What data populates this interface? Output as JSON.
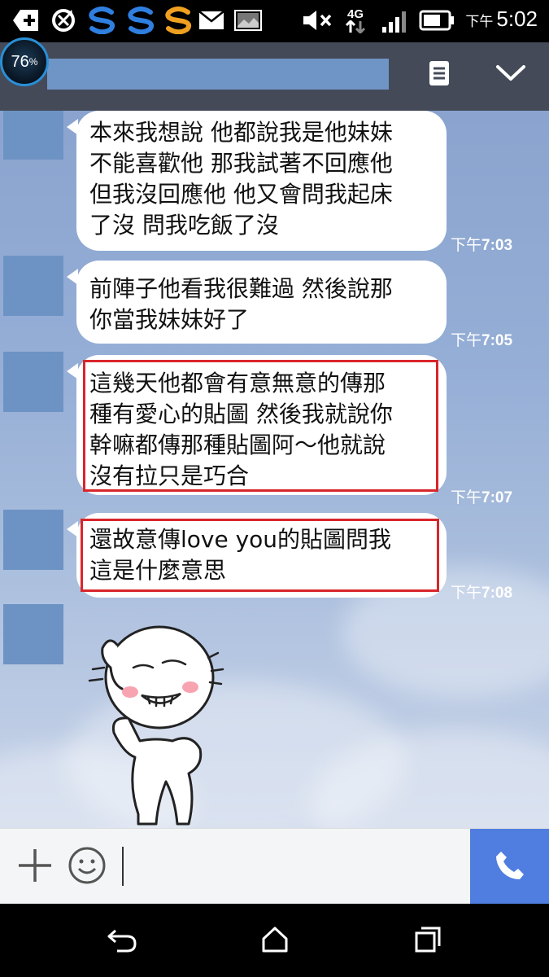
{
  "status_bar": {
    "time_prefix": "下午",
    "time": "5:02",
    "network": "4G",
    "icons": [
      "add-icon",
      "sync-icon",
      "s-app-icon",
      "s-app-icon",
      "s-app-icon",
      "mail-icon",
      "image-icon",
      "mute-icon",
      "network-4g-icon",
      "signal-icon",
      "battery-icon"
    ]
  },
  "battery_badge": {
    "percent": "76",
    "unit": "%"
  },
  "header": {
    "menu_icon": "notes-icon",
    "collapse_icon": "chevron-down-icon"
  },
  "messages": [
    {
      "text": "本來我想說 他都說我是他妹妹\n不能喜歡他 那我試著不回應他\n但我沒回應他 他又會問我起床\n了沒 問我吃飯了沒",
      "time_prefix": "下午",
      "time": "7:03",
      "highlighted": false
    },
    {
      "text": "前陣子他看我很難過 然後說那\n你當我妹妹好了",
      "time_prefix": "下午",
      "time": "7:05",
      "highlighted": false
    },
    {
      "text": "這幾天他都會有意無意的傳那\n種有愛心的貼圖 然後我就說你\n幹嘛都傳那種貼圖阿～他就說\n沒有拉只是巧合",
      "time_prefix": "下午",
      "time": "7:07",
      "highlighted": true
    },
    {
      "text": "還故意傳love you的貼圖問我\n這是什麼意思",
      "time_prefix": "下午",
      "time": "7:08",
      "highlighted": true
    }
  ],
  "sticker": {
    "name": "smug-character-sticker"
  },
  "input_bar": {
    "plus_icon": "plus-icon",
    "emoji_icon": "smiley-icon",
    "call_icon": "phone-icon",
    "value": ""
  },
  "nav_bar": {
    "icons": [
      "back-icon",
      "home-icon",
      "recent-apps-icon"
    ]
  },
  "colors": {
    "header": "#444a58",
    "call_button": "#4f7ee0",
    "highlight_border": "#d8262b",
    "avatar_placeholder": "#6d93c4"
  }
}
